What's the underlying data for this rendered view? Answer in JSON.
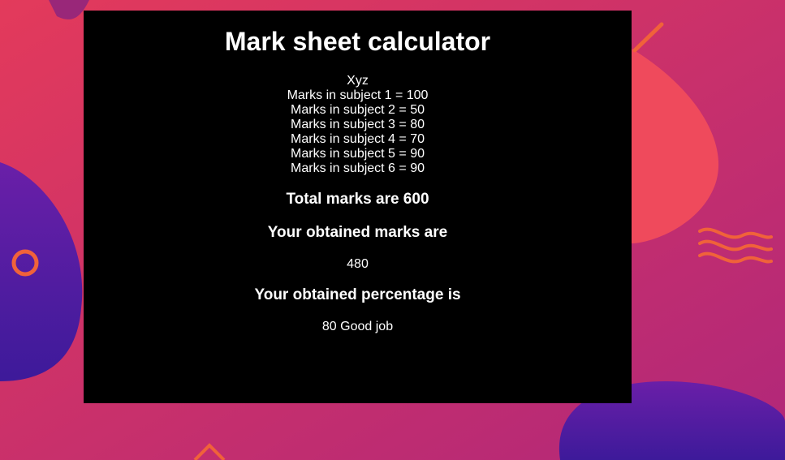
{
  "page": {
    "title": "Mark sheet calculator",
    "student_name": "Xyz",
    "subjects": [
      "Marks in subject 1 = 100",
      "Marks in subject 2 = 50",
      "Marks in subject 3 = 80",
      "Marks in subject 4 = 70",
      "Marks in subject 5 = 90",
      "Marks in subject 6 = 90"
    ],
    "total_heading": "Total marks are 600",
    "obtained_heading": "Your obtained marks are",
    "obtained_value": "480",
    "percentage_heading": "Your obtained percentage is",
    "percentage_value": "80 Good job"
  },
  "colors": {
    "panel_bg": "#000000",
    "text": "#ffffff",
    "bg_pink": "#d8345f",
    "bg_purple": "#5a1e9e",
    "accent_orange": "#f0623a"
  }
}
